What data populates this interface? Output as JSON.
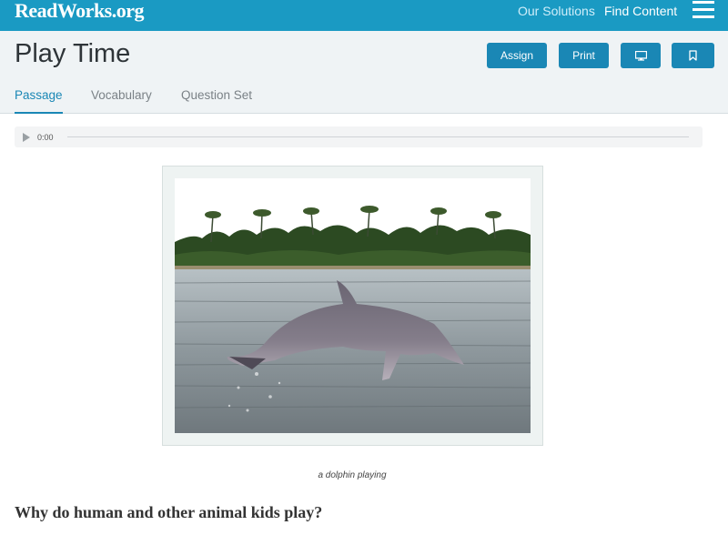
{
  "topbar": {
    "logo": "ReadWorks.org",
    "nav": [
      "Our Solutions",
      "Find Content"
    ],
    "menu_icon": "hamburger-menu-icon",
    "bg_color": "#1a9ac3"
  },
  "header": {
    "title": "Play Time",
    "buttons": {
      "assign": "Assign",
      "print": "Print",
      "present_icon": "monitor-icon",
      "bookmark_icon": "bookmark-icon"
    },
    "button_color": "#1a87b5",
    "tabs": [
      "Passage",
      "Vocabulary",
      "Question Set"
    ],
    "active_tab": "Passage"
  },
  "audio": {
    "time": "0:00",
    "progress": 0
  },
  "figure": {
    "image_icon": "dolphin-photo",
    "caption": "a dolphin playing"
  },
  "content": {
    "heading": "Why do human and other animal kids play?"
  }
}
